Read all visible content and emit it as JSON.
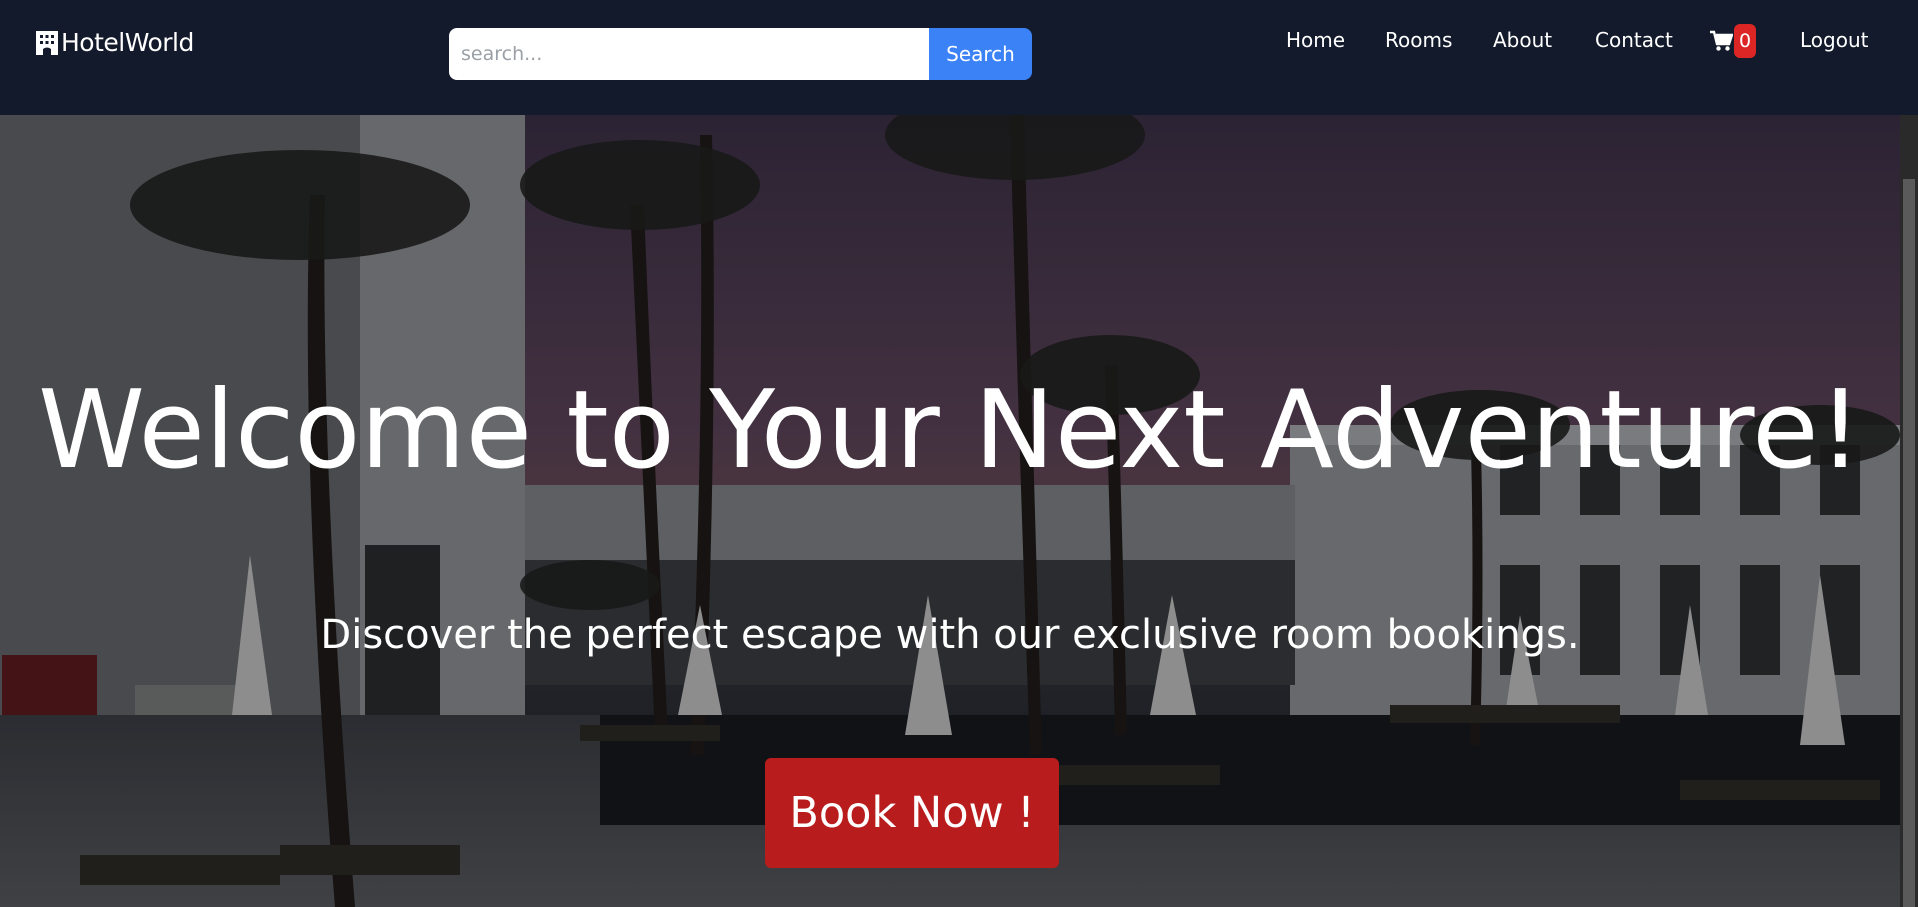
{
  "navbar": {
    "brand_name": "HotelWorld",
    "brand_icon": "hotel-icon",
    "search": {
      "placeholder": "search...",
      "value": "",
      "button_label": "Search"
    },
    "links": [
      {
        "label": "Home"
      },
      {
        "label": "Rooms"
      },
      {
        "label": "About"
      },
      {
        "label": "Contact"
      }
    ],
    "cart": {
      "icon": "cart-icon",
      "count": "0"
    },
    "logout_label": "Logout"
  },
  "hero": {
    "title": "Welcome to Your Next Adventure!",
    "subtitle": "Discover the perfect escape with our exclusive room bookings.",
    "cta_label": "Book Now !"
  },
  "colors": {
    "navbar_bg": "#131a2c",
    "search_button": "#3b82f6",
    "cart_badge": "#dc2626",
    "cta_button": "#b91c1c"
  }
}
